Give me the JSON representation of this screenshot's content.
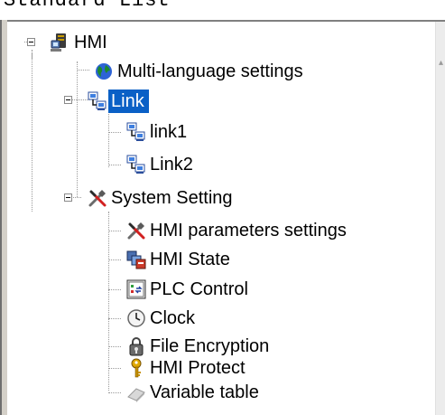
{
  "header_clip_text": "Standard List",
  "tree": {
    "root": {
      "label": "HMI",
      "icon": "hmi-server-icon",
      "expanded": true
    },
    "multi_language": {
      "label": "Multi-language settings",
      "icon": "globe-icon"
    },
    "link": {
      "label": "Link",
      "icon": "network-icon",
      "expanded": true,
      "selected": true
    },
    "link1": {
      "label": "link1",
      "icon": "network-icon"
    },
    "link2": {
      "label": "Link2",
      "icon": "network-icon"
    },
    "system_setting": {
      "label": "System Setting",
      "icon": "tools-icon",
      "expanded": true
    },
    "hmi_parameters": {
      "label": "HMI parameters settings",
      "icon": "tools-icon"
    },
    "hmi_state": {
      "label": "HMI State",
      "icon": "state-icon"
    },
    "plc_control": {
      "label": "PLC Control",
      "icon": "plc-icon"
    },
    "clock": {
      "label": "Clock",
      "icon": "clock-icon"
    },
    "file_encryption": {
      "label": "File Encryption",
      "icon": "padlock-icon"
    },
    "hmi_protect": {
      "label": "HMI Protect",
      "icon": "key-icon"
    },
    "variable_table": {
      "label": "Variable table",
      "icon": "eraser-icon"
    }
  },
  "colors": {
    "selection": "#0a60c6",
    "tree_lines": "#9a9a9a",
    "frame": "#d4d0c8"
  }
}
